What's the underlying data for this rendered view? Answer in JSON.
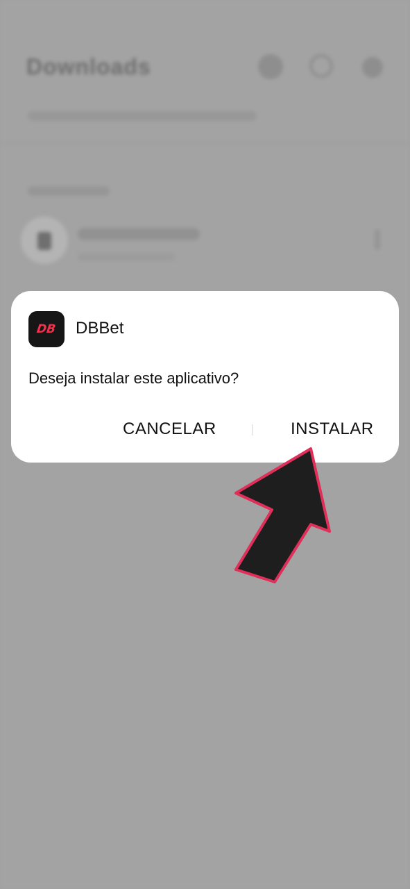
{
  "background": {
    "title": "Downloads"
  },
  "dialog": {
    "app_icon_text": "DB",
    "app_name": "DBBet",
    "message": "Deseja instalar este aplicativo?",
    "cancel_label": "CANCELAR",
    "install_label": "INSTALAR"
  },
  "colors": {
    "scrim": "#a0a0a0",
    "dialog_bg": "#ffffff",
    "app_icon_bg": "#161616",
    "app_icon_accent": "#f2304c",
    "arrow_fill": "#1e1e1e",
    "arrow_outline": "#e0305a"
  },
  "icons": {
    "arrow": "pointer-arrow-icon"
  }
}
